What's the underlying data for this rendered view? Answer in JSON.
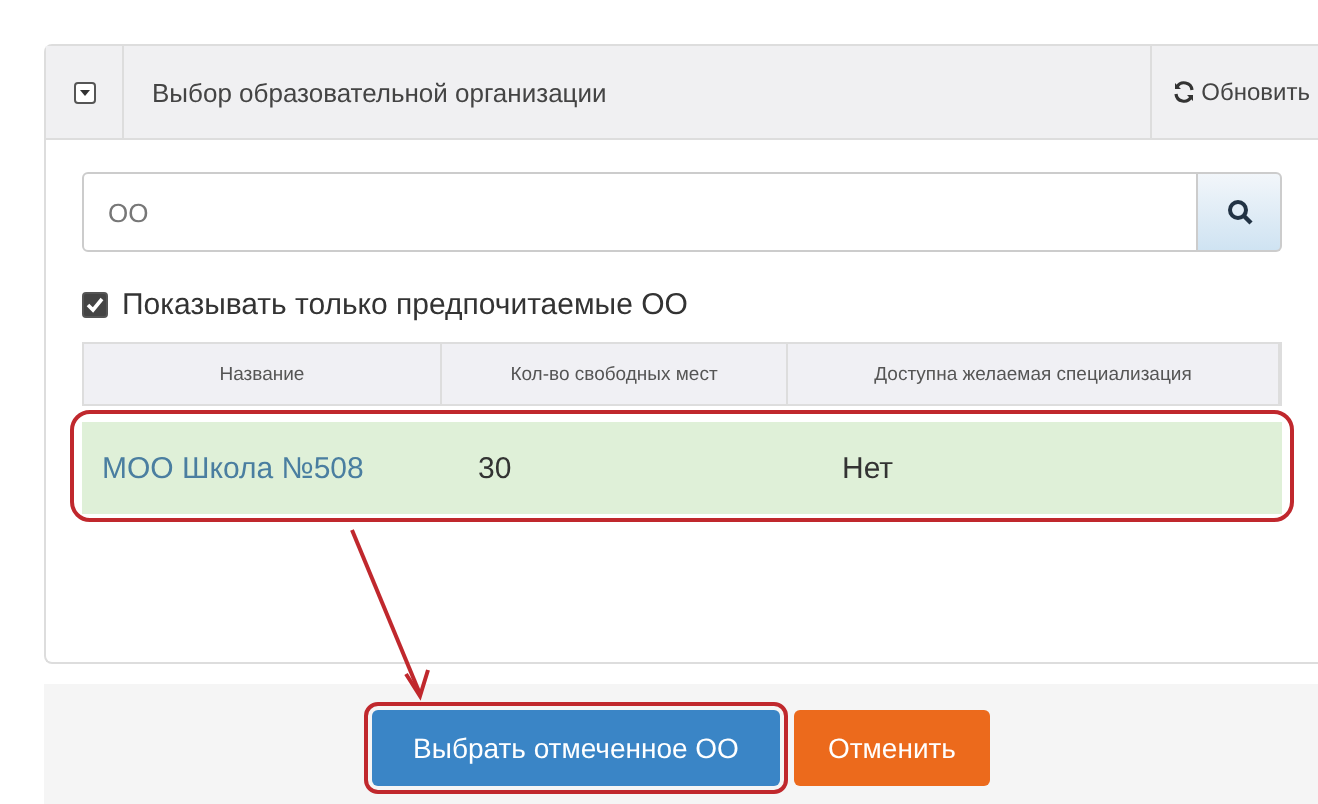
{
  "panel": {
    "title": "Выбор образовательной организации",
    "expanded": true,
    "refresh_label": "Обновить"
  },
  "search": {
    "value": "ОО"
  },
  "filter": {
    "label": "Показывать только предпочитаемые ОО",
    "checked": true
  },
  "table": {
    "columns": [
      "Название",
      "Кол-во свободных мест",
      "Доступна желаемая специализация"
    ],
    "rows": [
      {
        "cells": [
          "МОО Школа №508",
          "30",
          "Нет"
        ],
        "selected": true
      }
    ]
  },
  "buttons": [
    {
      "label": "Выбрать отмеченное ОО",
      "kind": "primary"
    },
    {
      "label": "Отменить",
      "kind": "danger"
    }
  ]
}
